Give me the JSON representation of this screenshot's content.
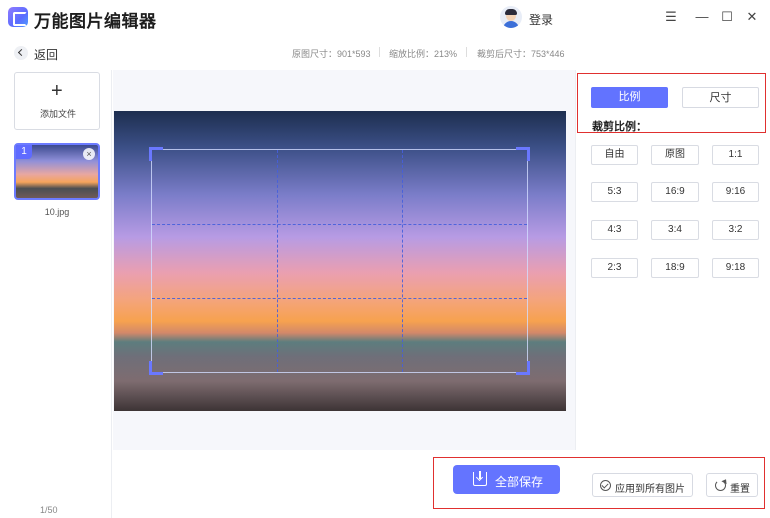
{
  "app": {
    "title": "万能图片编辑器",
    "login_label": "登录"
  },
  "window_controls": {
    "menu": "☰",
    "minimize": "—",
    "maximize": "☐",
    "close": "✕"
  },
  "subbar": {
    "back_label": "返回",
    "original_size": "原图尺寸：901*593",
    "zoom_ratio": "缩放比例：213%",
    "cropped_size": "裁剪后尺寸：753*446"
  },
  "file_list": {
    "add_label": "添加文件",
    "add_icon": "+",
    "items": [
      {
        "index": "1",
        "name": "10.jpg",
        "close_icon": "×"
      }
    ],
    "page_count": "1/50"
  },
  "crop_panel": {
    "tabs": [
      {
        "label": "比例",
        "active": true
      },
      {
        "label": "尺寸",
        "active": false
      }
    ],
    "ratio_title": "裁剪比例：",
    "ratios": [
      "自由",
      "原图",
      "1:1",
      "5:3",
      "16:9",
      "9:16",
      "4:3",
      "3:4",
      "3:2",
      "2:3",
      "18:9",
      "9:18"
    ],
    "selected_ratio": "自由"
  },
  "actions": {
    "save_all_label": "全部保存",
    "apply_all_label": "应用到所有图片",
    "reset_label": "重置"
  },
  "colors": {
    "accent": "#6273ff",
    "highlight_box": "#e0302f"
  }
}
